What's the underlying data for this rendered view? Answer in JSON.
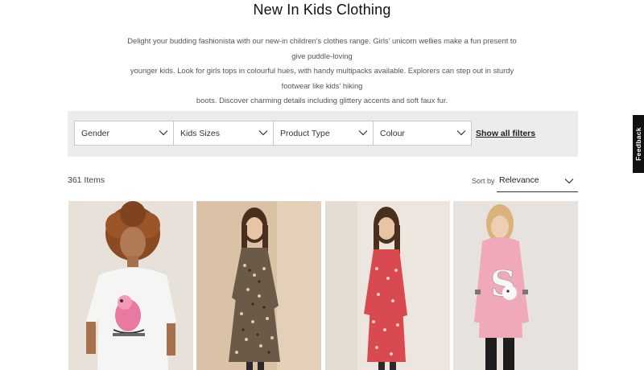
{
  "page": {
    "title": "New In Kids Clothing",
    "intro_lines": [
      "Delight your budding fashionista with our new-in children's clothes range. Girls' unicorn wellies make a fun present to give puddle-loving",
      "younger kids. Look for girls tops in colourful hues, with handy multipacks available. Explorers can step out in sturdy footwear like kids' hiking",
      "boots. Discover charming details including glittery accents and soft faux fur."
    ]
  },
  "filters": {
    "items": [
      {
        "label": "Gender"
      },
      {
        "label": "Kids Sizes"
      },
      {
        "label": "Product Type"
      },
      {
        "label": "Colour"
      }
    ],
    "show_all_label": "Show all filters"
  },
  "results": {
    "count_text": "361 Items",
    "sort_label": "Sort by",
    "sort_value": "Relevance"
  },
  "feedback": {
    "label": "Feedback"
  },
  "products": [
    {
      "image": "girl-curly-hair-white-graphic-tshirt"
    },
    {
      "image": "girl-floral-print-smock-dress"
    },
    {
      "image": "girl-red-floral-ruffle-dress"
    },
    {
      "image": "girl-pink-sequin-hoodie-dress"
    }
  ],
  "colors": {
    "filter_bar_bg": "#ececec",
    "feedback_bg": "#111111"
  }
}
